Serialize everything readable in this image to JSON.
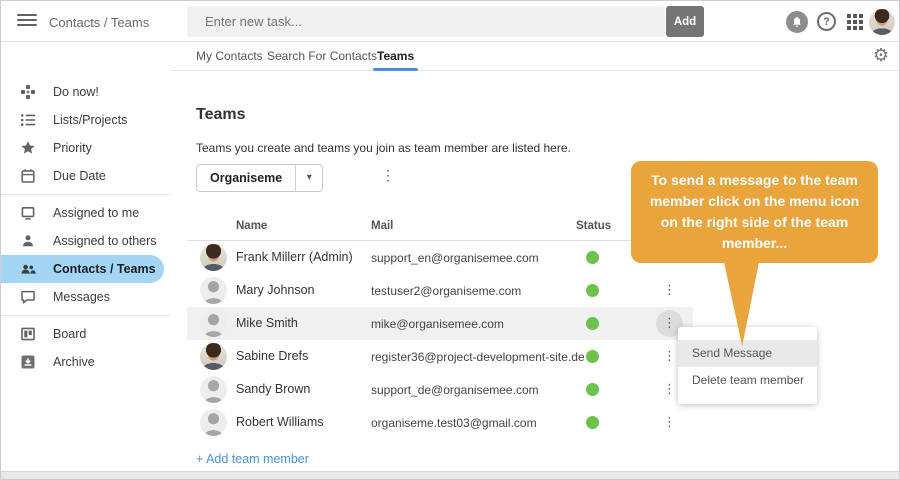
{
  "topbar": {
    "title": "Contacts / Teams",
    "task_placeholder": "Enter new task...",
    "add_label": "Add",
    "help_glyph": "?"
  },
  "tabs": [
    {
      "label": "My Contacts",
      "active": false
    },
    {
      "label": "Search For Contacts",
      "active": false
    },
    {
      "label": "Teams",
      "active": true
    }
  ],
  "sidebar": {
    "items": [
      {
        "label": "Do now!",
        "icon": "do-now-icon",
        "active": false
      },
      {
        "label": "Lists/Projects",
        "icon": "lists-projects-icon",
        "active": false
      },
      {
        "label": "Priority",
        "icon": "priority-star-icon",
        "active": false
      },
      {
        "label": "Due Date",
        "icon": "due-date-calendar-icon",
        "active": false
      },
      {
        "label": "Assigned to me",
        "icon": "assigned-to-me-icon",
        "active": false
      },
      {
        "label": "Assigned to others",
        "icon": "assigned-to-others-icon",
        "active": false
      },
      {
        "label": "Contacts / Teams",
        "icon": "contacts-teams-icon",
        "active": true
      },
      {
        "label": "Messages",
        "icon": "messages-icon",
        "active": false
      },
      {
        "label": "Board",
        "icon": "board-icon",
        "active": false
      },
      {
        "label": "Archive",
        "icon": "archive-icon",
        "active": false
      }
    ]
  },
  "content": {
    "heading": "Teams",
    "description": "Teams you create and teams you join as team member are listed here.",
    "team_selector": {
      "value": "Organiseme"
    },
    "table": {
      "headers": [
        "Name",
        "Mail",
        "Status"
      ],
      "rows": [
        {
          "name": "Frank Millerr (Admin)",
          "mail": "support_en@organisemee.com",
          "status": "online",
          "avatar": "photo",
          "highlighted": false,
          "menu_open": false
        },
        {
          "name": "Mary Johnson",
          "mail": "testuser2@organiseme.com",
          "status": "online",
          "avatar": "placeholder",
          "highlighted": false,
          "menu_open": false
        },
        {
          "name": "Mike Smith",
          "mail": "mike@organisemee.com",
          "status": "online",
          "avatar": "placeholder",
          "highlighted": true,
          "menu_open": true
        },
        {
          "name": "Sabine Drefs",
          "mail": "register36@project-development-site.de",
          "status": "online",
          "avatar": "photo",
          "highlighted": false,
          "menu_open": false
        },
        {
          "name": "Sandy Brown",
          "mail": "support_de@organisemee.com",
          "status": "online",
          "avatar": "placeholder",
          "highlighted": false,
          "menu_open": false
        },
        {
          "name": "Robert Williams",
          "mail": "organiseme.test03@gmail.com",
          "status": "online",
          "avatar": "placeholder",
          "highlighted": false,
          "menu_open": false
        }
      ]
    },
    "add_member_label": "+ Add team member"
  },
  "callout": {
    "text": "To send a message to the team member click on the menu icon on the right side of the team member...",
    "color": "#e9a43c"
  },
  "context_menu": {
    "items": [
      {
        "label": "Send Message",
        "highlighted": true
      },
      {
        "label": "Delete team member",
        "highlighted": false
      }
    ]
  },
  "colors": {
    "accent_blue": "#4a90e2",
    "active_nav_bg": "#a3d6f5",
    "status_green": "#6cc24a",
    "callout_orange": "#e9a43c",
    "add_button_gray": "#757575"
  }
}
